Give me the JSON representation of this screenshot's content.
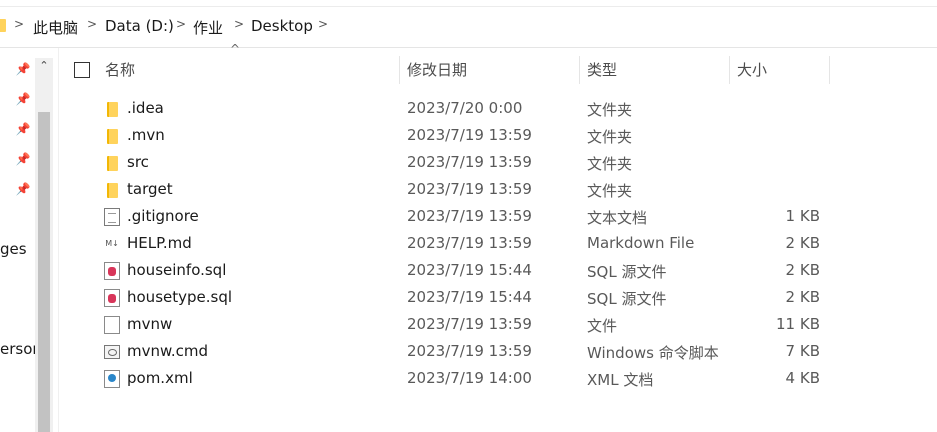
{
  "breadcrumb": {
    "items": [
      "此电脑",
      "Data (D:)",
      "作业",
      "Desktop"
    ],
    "separator": ">"
  },
  "nav": {
    "partial_labels": [
      "ges",
      "ersor"
    ]
  },
  "columns": {
    "name": "名称",
    "date": "修改日期",
    "type": "类型",
    "size": "大小"
  },
  "files": [
    {
      "name": ".idea",
      "date": "2023/7/20 0:00",
      "type": "文件夹",
      "size": "",
      "icon": "folder-icon"
    },
    {
      "name": ".mvn",
      "date": "2023/7/19 13:59",
      "type": "文件夹",
      "size": "",
      "icon": "folder-icon"
    },
    {
      "name": "src",
      "date": "2023/7/19 13:59",
      "type": "文件夹",
      "size": "",
      "icon": "folder-icon"
    },
    {
      "name": "target",
      "date": "2023/7/19 13:59",
      "type": "文件夹",
      "size": "",
      "icon": "folder-icon"
    },
    {
      "name": ".gitignore",
      "date": "2023/7/19 13:59",
      "type": "文本文档",
      "size": "1 KB",
      "icon": "text-document-icon"
    },
    {
      "name": "HELP.md",
      "date": "2023/7/19 13:59",
      "type": "Markdown File",
      "size": "2 KB",
      "icon": "markdown-file-icon"
    },
    {
      "name": "houseinfo.sql",
      "date": "2023/7/19 15:44",
      "type": "SQL 源文件",
      "size": "2 KB",
      "icon": "sql-file-icon"
    },
    {
      "name": "housetype.sql",
      "date": "2023/7/19 15:44",
      "type": "SQL 源文件",
      "size": "2 KB",
      "icon": "sql-file-icon"
    },
    {
      "name": "mvnw",
      "date": "2023/7/19 13:59",
      "type": "文件",
      "size": "11 KB",
      "icon": "generic-file-icon"
    },
    {
      "name": "mvnw.cmd",
      "date": "2023/7/19 13:59",
      "type": "Windows 命令脚本",
      "size": "7 KB",
      "icon": "command-script-icon"
    },
    {
      "name": "pom.xml",
      "date": "2023/7/19 14:00",
      "type": "XML 文档",
      "size": "4 KB",
      "icon": "xml-document-icon"
    }
  ],
  "colors": {
    "folder": "#ffd35c",
    "sql": "#d8365a",
    "xml": "#2a86c9",
    "text_muted": "#595959",
    "scrollbar_track": "#f0f0f0",
    "scrollbar_thumb": "#c2c2c2"
  }
}
